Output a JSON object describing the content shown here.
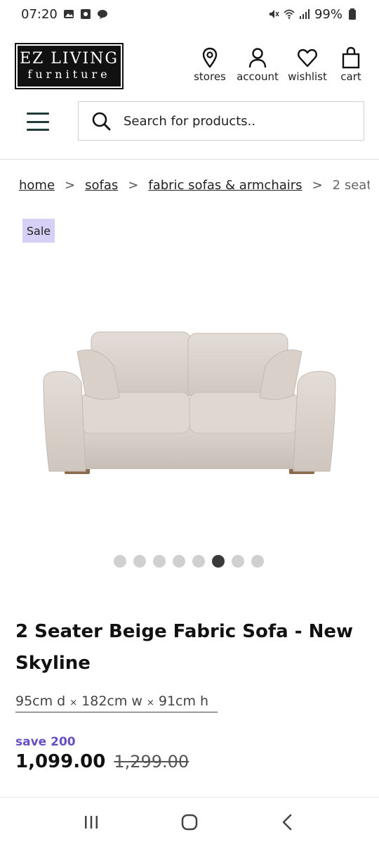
{
  "status_bar": {
    "time": "07:20",
    "battery": "99%"
  },
  "header": {
    "logo_line1": "EZ LIVING",
    "logo_line2": "furniture",
    "nav": {
      "stores": "stores",
      "account": "account",
      "wishlist": "wishlist",
      "cart": "cart"
    }
  },
  "search": {
    "placeholder": "Search for products.."
  },
  "breadcrumb": {
    "items": [
      "home",
      "sofas",
      "fabric sofas & armchairs"
    ],
    "current": "2 seat...",
    "separator": ">"
  },
  "badge": {
    "label": "Sale"
  },
  "carousel": {
    "total": 8,
    "active_index": 5
  },
  "product": {
    "title": "2 Seater Beige Fabric Sofa - New Skyline",
    "dim_d": "95cm d",
    "dim_w": "182cm w",
    "dim_h": "91cm h",
    "dim_sep": "×",
    "save_text": "save 200",
    "price": "1,099.00",
    "was_price": "1,299.00"
  },
  "colors": {
    "accent_purple": "#6a4fc4",
    "badge_bg": "#d7d0f6",
    "menu_teal": "#1f3b3a"
  }
}
